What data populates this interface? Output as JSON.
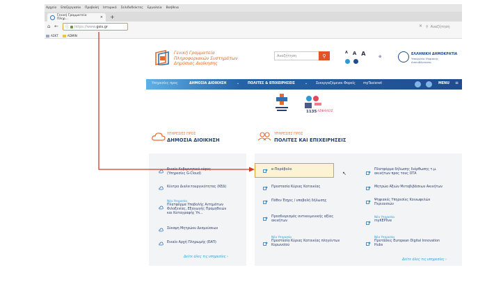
{
  "browser": {
    "menu": [
      "Αρχείο",
      "Επεξεργασία",
      "Προβολή",
      "Ιστορικό",
      "Σελιδοδείκτες",
      "Εργαλεία",
      "Βοήθεια"
    ],
    "tab_title": "Γενική Γραμματεία Πληρ...",
    "url_prefix": "https://www.",
    "url_domain": "gsis.gr",
    "search_placeholder": "Αναζήτηση",
    "bookmarks": [
      "ΑΣΚΤ",
      "ADMIN"
    ]
  },
  "header": {
    "logo_line1": "Γενική Γραμματεία",
    "logo_line2": "Πληροφοριακών Συστημάτων",
    "logo_line3": "Δημόσιας Διοίκησης",
    "search_placeholder": "Αναζήτηση",
    "font_sizes": [
      "A",
      "A",
      "A"
    ],
    "gov_title": "ΕΛΛΗΝΙΚΗ ΔΗΜΟΚΡΑΤΙΑ",
    "gov_sub1": "Υπουργείο Ψηφιακής",
    "gov_sub2": "Διακυβέρνησης"
  },
  "nav": {
    "services_for": "Υπηρεσίες προς",
    "public_admin": "ΔΗΜΟΣΙΑ ΔΙΟΙΚΗΣΗ",
    "citizens": "ΠΟΛΙΤΕΣ & ΕΠΙΧΕΙΡΗΣΕΙΣ",
    "partner": "Συνεργαζόμενοι Φορείς",
    "mytaxisnet": "myTaxisnet",
    "menu": "MENU"
  },
  "ads": {
    "ad2_number": "1135",
    "ad2_label": "ΑΣΦΑΛΕΙΣ"
  },
  "left_section": {
    "subtitle": "ΥΠΗΡΕΣΙΕΣ ΠΡΟΣ",
    "title": "ΔΗΜΟΣΙΑ ΔΙΟΙΚΗΣΗ",
    "items": [
      {
        "label1": "Ενιαίο Κυβερνητικό νέφος",
        "label2": "(Υπηρεσίες G-Cloud)",
        "new": ""
      },
      {
        "label1": "Κέντρο Διαλειτουργικότητας (ΚΕΔ)",
        "label2": "",
        "new": ""
      },
      {
        "label1": "Πλατφόρμα Υποβολής Αιτημάτων",
        "label2": "Φιλοξενίας, Εξαγωγής Προμηθειών",
        "label3": "και Καταγραφής Υπ...",
        "new": "Νέα Υπηρεσία"
      },
      {
        "label1": "Σύνοψη Μητρώου Δεσμεύσεων",
        "label2": "",
        "new": ""
      },
      {
        "label1": "Ενιαίο Αρχή Πληρωμής (ΕΑΠ)",
        "label2": "",
        "new": ""
      }
    ],
    "more": "Δείτε όλες τις υπηρεσίες"
  },
  "right_section": {
    "subtitle": "ΥΠΗΡΕΣΙΕΣ ΠΡΟΣ",
    "title": "ΠΟΛΙΤΕΣ ΚΑΙ ΕΠΙΧΕΙΡΗΣΕΙΣ",
    "col1": [
      {
        "label1": "e-Παράβολο",
        "label2": "",
        "new": ""
      },
      {
        "label1": "Προστασία Κύριας Κατοικίας",
        "label2": "",
        "new": ""
      },
      {
        "label1": "Πόθεν Έσχες / υποβολή δήλωσης",
        "label2": "",
        "new": ""
      },
      {
        "label1": "Προσδιορισμός αντικειμενικής αξίας",
        "label2": "ακινήτων",
        "new": ""
      },
      {
        "label1": "Προστασία Κύριας Κατοικίας πληγέντων",
        "label2": "Κορωνοϊού",
        "new": "Νέα Υπηρεσία"
      }
    ],
    "col2": [
      {
        "label1": "Πλατφόρμα δήλωσης διόρθωσης τ.μ.",
        "label2": "ακινήτων προς τους ΟΤΑ",
        "new": ""
      },
      {
        "label1": "Μητρώο Αξιών Μεταβιβάσεων Ακινήτων",
        "label2": "",
        "new": ""
      },
      {
        "label1": "Ψηφιακές Υπηρεσίες Κοινωφελών",
        "label2": "Περιουσιών",
        "new": ""
      },
      {
        "label1": "myKEPlive",
        "label2": "",
        "new": "Νέα Υπηρεσία"
      },
      {
        "label1": "Προτάσεις European Digital Innovation",
        "label2": "Hubs",
        "new": "Νέα Υπηρεσία"
      }
    ],
    "more": "Δείτε όλες τις υπηρεσίες"
  },
  "colors": {
    "accent_orange": "#e46b2a",
    "nav_blue": "#2563a6",
    "highlight": "#d9a32b",
    "arrow": "#d23a2a"
  }
}
